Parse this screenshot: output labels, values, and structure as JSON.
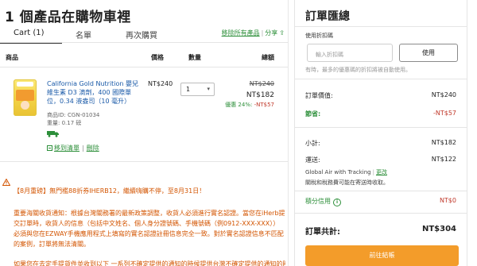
{
  "page_title": "1 個產品在購物車裡",
  "tabs": [
    {
      "label": "Cart (1)",
      "active": true
    },
    {
      "label": "名單",
      "active": false
    },
    {
      "label": "再次購買",
      "active": false
    }
  ],
  "share": {
    "remove_all": "移除所有產品",
    "share": "分享"
  },
  "table_headers": {
    "product": "商品",
    "price": "價格",
    "qty": "數量",
    "total": "總額"
  },
  "product": {
    "name": "California Gold Nutrition 嬰兒維生素 D3 滴劑，400 國際單位，0.34 液盎司（10 毫升）",
    "code": "商品ID: CGN-01034",
    "weight": "重量: 0.17 磅",
    "move_to_list": "移到清單",
    "remove": "刪除",
    "price": "NT$240",
    "qty": "1",
    "total_old": "NT$240",
    "total_new": "NT$182",
    "savings_label": "優惠 24%:",
    "savings_value": "-NT$57"
  },
  "notices": {
    "n1": "【8月重磅】無門檻88折券IHERB12，繼續嗨購不停，至8月31日！",
    "n2": "重要海關收貨通知：根據台灣關務署的最新政策調整，收貨人必須進行實名認證。當您在iHerb提交訂單時，收貨人的信息（包括中文姓名、個人身分證號碼、手機號碼（例0912-XXX-XXX））必須與您在EZWAY手機應用程式上填寫的實名認證註冊信息完全一致。對於實名認證信息不匹配的案例，訂單將無法清關。",
    "n3": "如果您在去定手提貨件並收到以下 一系列不確定提供的通知的時候提供台灣不確定提供的通知的時候提供台灣關務署"
  },
  "summary": {
    "title": "訂單匯總",
    "promo_label": "使用折扣碼",
    "promo_placeholder": "輸入折扣碼",
    "promo_button": "使用",
    "promo_hint": "有時，最多的優惠碼的折扣將被自動使用。",
    "order_value_label": "訂單價值:",
    "order_value": "NT$240",
    "savings_label": "節省:",
    "savings_value": "-NT$57",
    "subtotal_label": "小計:",
    "subtotal_value": "NT$182",
    "shipping_label": "運送:",
    "shipping_value": "NT$122",
    "shipping_method": "Global Air with Tracking",
    "shipping_change": "更改",
    "shipping_note": "關稅和稅務費可能在寄送時收取。",
    "rewards_label": "積分信用",
    "rewards_value": "NT$0",
    "grand_label": "訂單共計:",
    "grand_value": "NT$304",
    "checkout": "前往結帳"
  },
  "colors": {
    "accent_green": "#2d8f3a",
    "checkout_orange": "#f39c2a",
    "notice_orange": "#d35400",
    "discount_red": "#c0392b"
  }
}
